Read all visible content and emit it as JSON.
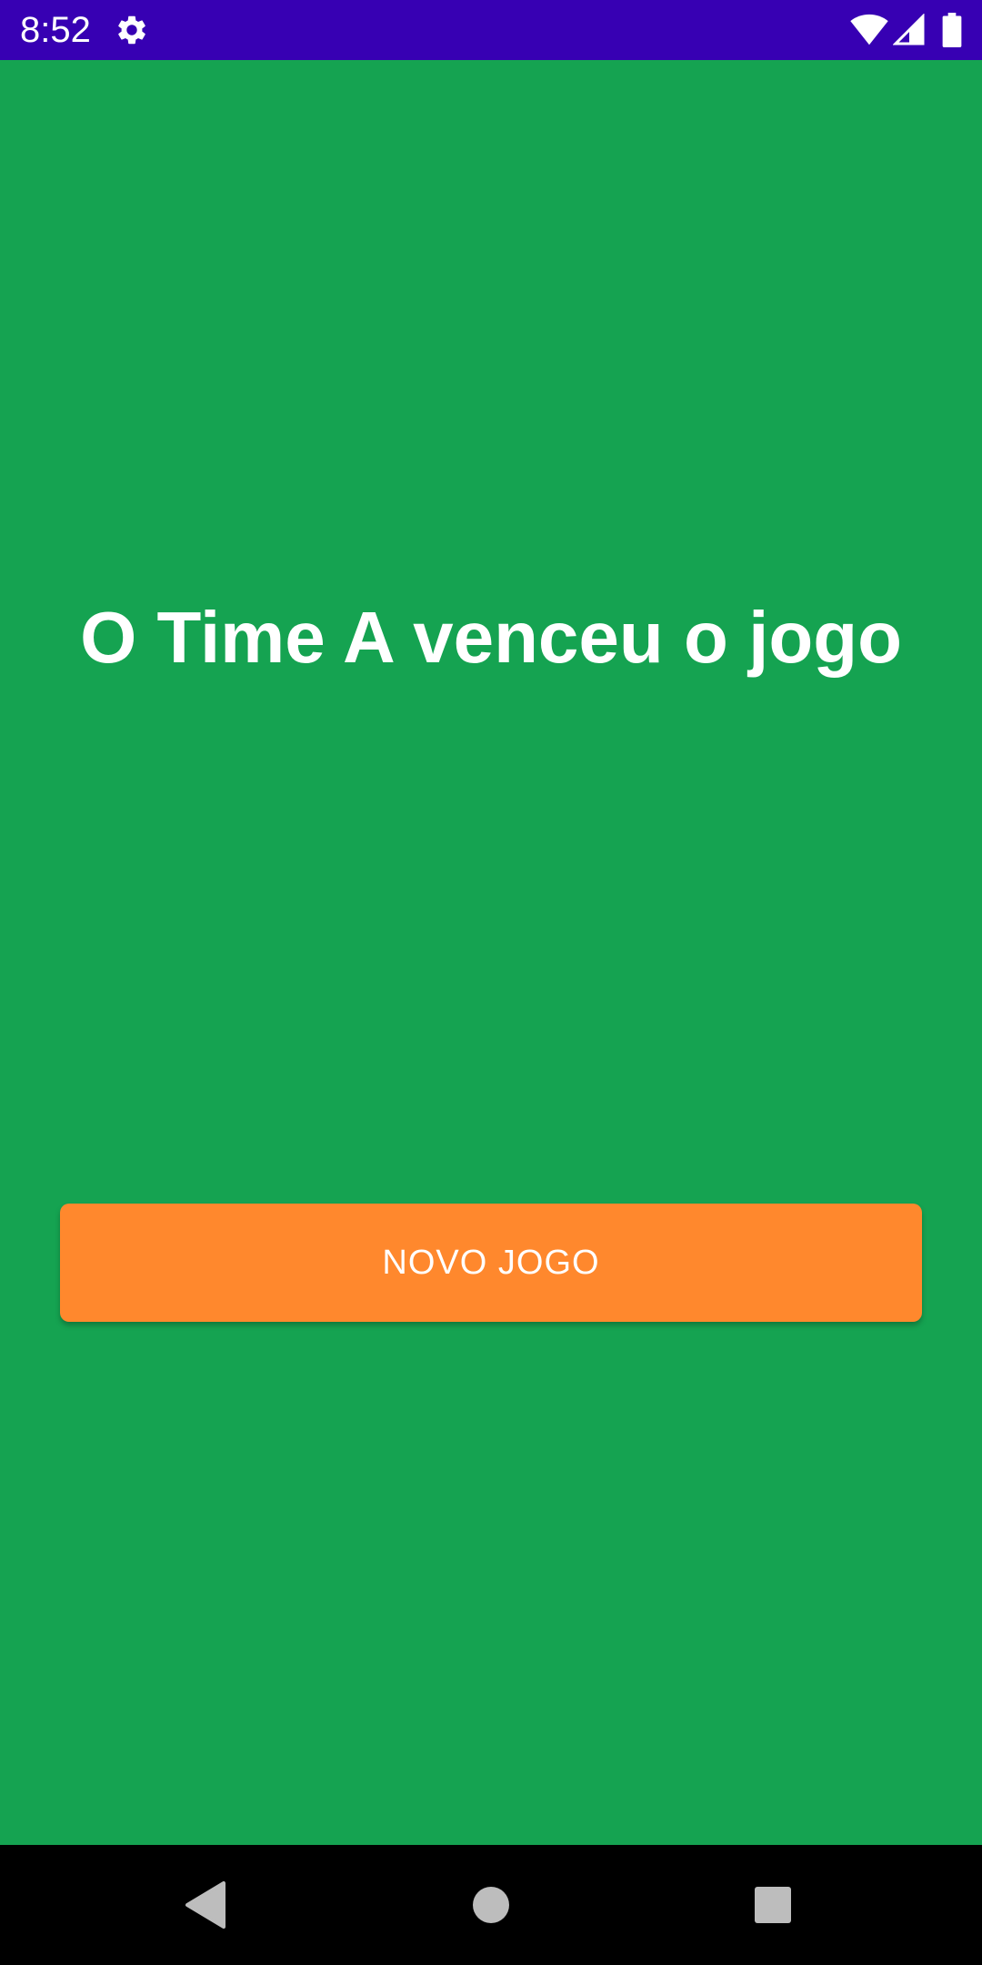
{
  "status_bar": {
    "time": "8:52",
    "background_color": "#3700b3",
    "icons": [
      "gear-icon",
      "wifi-icon",
      "cell-signal-icon",
      "battery-icon"
    ]
  },
  "main": {
    "background_color": "#15a351",
    "result_text": "O Time A venceu o jogo",
    "new_game_button": {
      "label": "NOVO JOGO",
      "color": "#ff882d"
    }
  },
  "nav_bar": {
    "icons": [
      "back-icon",
      "home-icon",
      "recents-icon"
    ]
  }
}
